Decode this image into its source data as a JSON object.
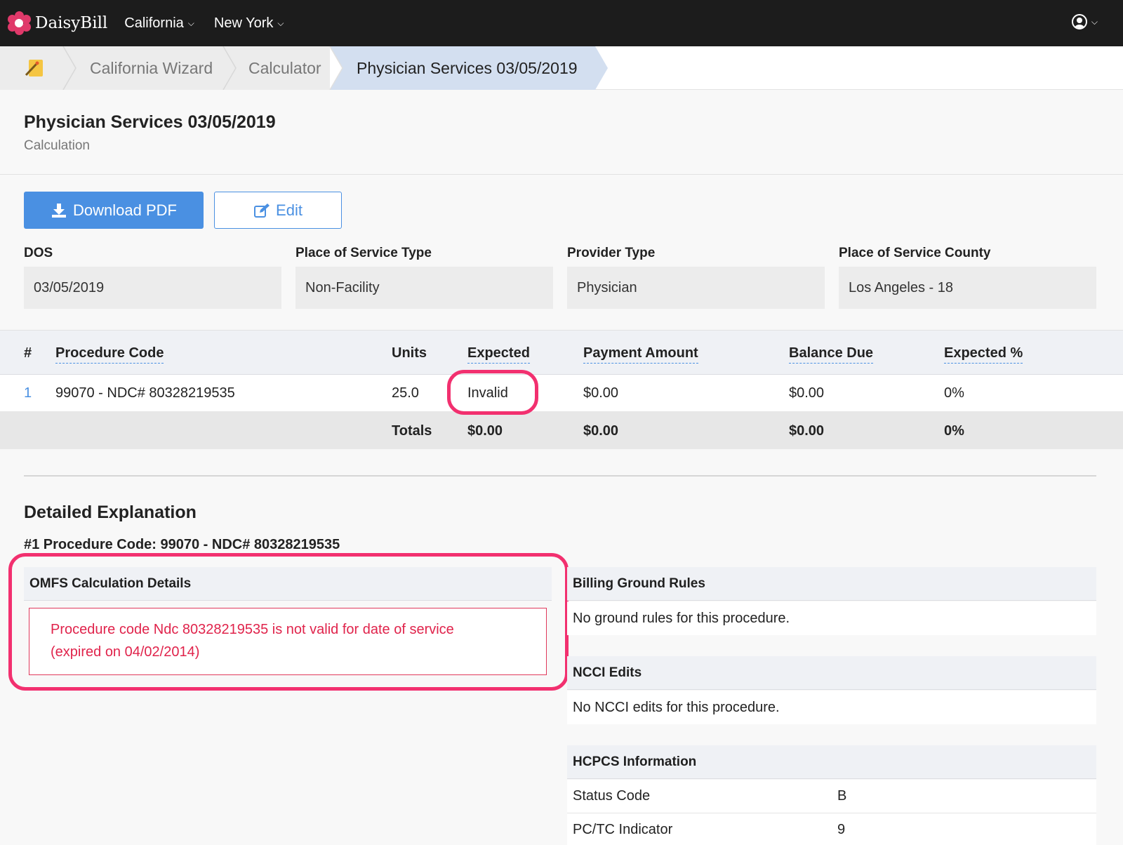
{
  "nav": {
    "brand": "DaisyBill",
    "menus": [
      {
        "label": "California"
      },
      {
        "label": "New York"
      }
    ]
  },
  "breadcrumb": {
    "items": [
      "California Wizard",
      "Calculator",
      "Physician Services 03/05/2019"
    ]
  },
  "page": {
    "title": "Physician Services 03/05/2019",
    "subtitle": "Calculation"
  },
  "actions": {
    "download_label": "Download PDF",
    "edit_label": "Edit"
  },
  "fields": [
    {
      "label": "DOS",
      "value": "03/05/2019"
    },
    {
      "label": "Place of Service Type",
      "value": "Non-Facility"
    },
    {
      "label": "Provider Type",
      "value": "Physician"
    },
    {
      "label": "Place of Service County",
      "value": "Los Angeles - 18"
    }
  ],
  "table": {
    "headers": {
      "num": "#",
      "procedure": "Procedure Code",
      "units": "Units",
      "expected": "Expected",
      "payment": "Payment Amount",
      "balance": "Balance Due",
      "expected_pct": "Expected %"
    },
    "row": {
      "num": "1",
      "procedure": "99070 - NDC# 80328219535",
      "units": "25.0",
      "expected": "Invalid",
      "payment": "$0.00",
      "balance": "$0.00",
      "expected_pct": "0%"
    },
    "totals": {
      "label": "Totals",
      "expected": "$0.00",
      "payment": "$0.00",
      "balance": "$0.00",
      "expected_pct": "0%"
    }
  },
  "explanation": {
    "title": "Detailed Explanation",
    "procedure_line": "#1 Procedure Code: 99070 - NDC# 80328219535",
    "omfs_title": "OMFS Calculation Details",
    "omfs_error_line1": "Procedure code Ndc 80328219535 is not valid for date of service",
    "omfs_error_line2": "(expired on 04/02/2014)",
    "ground_rules_title": "Billing Ground Rules",
    "ground_rules_text": "No ground rules for this procedure.",
    "ncci_title": "NCCI Edits",
    "ncci_text": "No NCCI edits for this procedure.",
    "hcpcs_title": "HCPCS Information",
    "hcpcs_rows": [
      {
        "key": "Status Code",
        "value": "B"
      },
      {
        "key": "PC/TC Indicator",
        "value": "9"
      }
    ]
  },
  "colors": {
    "primary": "#4a90e2",
    "highlight": "#f2306f",
    "error": "#e0234b",
    "nav_bg": "#1c1c1c",
    "breadcrumb_active": "#d3dff0"
  }
}
